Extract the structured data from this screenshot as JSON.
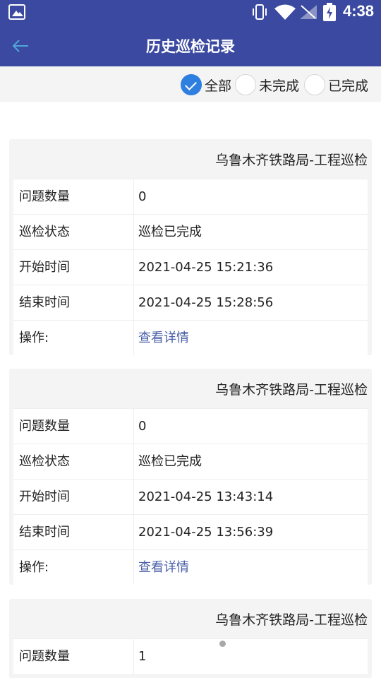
{
  "status_bar": {
    "time": "4:38"
  },
  "app_bar": {
    "title": "历史巡检记录"
  },
  "filters": [
    {
      "label": "全部",
      "checked": true
    },
    {
      "label": "未完成",
      "checked": false
    },
    {
      "label": "已完成",
      "checked": false
    }
  ],
  "records": [
    {
      "title": "乌鲁木齐铁路局-工程巡检",
      "rows": [
        {
          "key": "问题数量",
          "value": "0"
        },
        {
          "key": "巡检状态",
          "value": "巡检已完成"
        },
        {
          "key": "开始时间",
          "value": "2021-04-25 15:21:36"
        },
        {
          "key": "结束时间",
          "value": "2021-04-25 15:28:56"
        },
        {
          "key": "操作:",
          "value": "查看详情"
        }
      ]
    },
    {
      "title": "乌鲁木齐铁路局-工程巡检",
      "rows": [
        {
          "key": "问题数量",
          "value": "0"
        },
        {
          "key": "巡检状态",
          "value": "巡检已完成"
        },
        {
          "key": "开始时间",
          "value": "2021-04-25 13:43:14"
        },
        {
          "key": "结束时间",
          "value": "2021-04-25 13:56:39"
        },
        {
          "key": "操作:",
          "value": "查看详情"
        }
      ]
    },
    {
      "title": "乌鲁木齐铁路局-工程巡检",
      "rows": [
        {
          "key": "问题数量",
          "value": "1"
        }
      ]
    }
  ],
  "colors": {
    "primary": "#3b4aa0",
    "radio_checked": "#2f7fe0",
    "link": "#4a5fa8",
    "card_bg": "#f4f4f4"
  }
}
